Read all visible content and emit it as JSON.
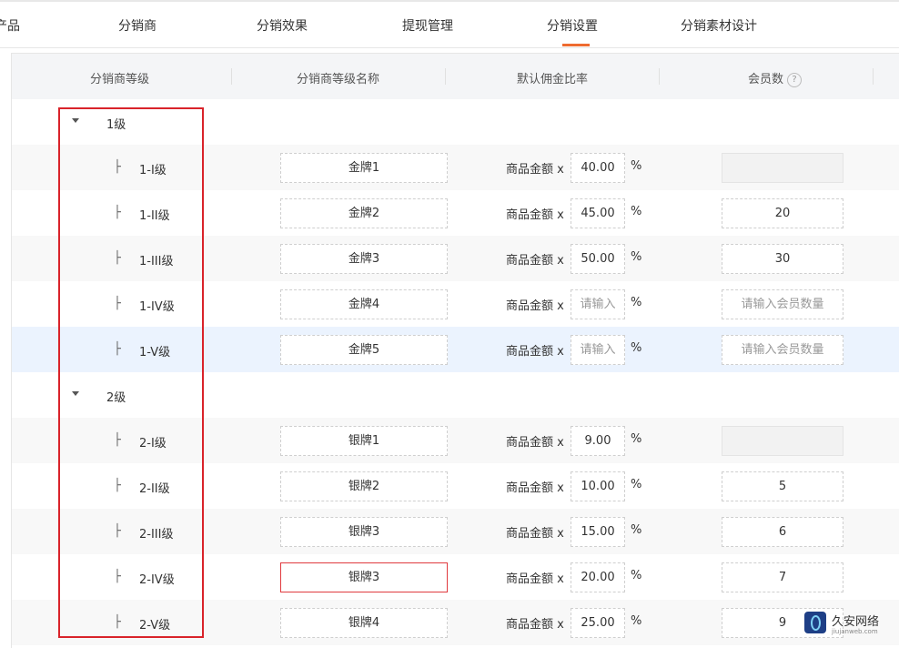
{
  "tabs": [
    {
      "label": "产品"
    },
    {
      "label": "分销商"
    },
    {
      "label": "分销效果"
    },
    {
      "label": "提现管理"
    },
    {
      "label": "分销设置"
    },
    {
      "label": "分销素材设计"
    }
  ],
  "active_tab": "分销设置",
  "table": {
    "headers": {
      "level": "分销商等级",
      "level_name": "分销商等级名称",
      "rate": "默认佣金比率",
      "members": "会员数",
      "members_help": "?"
    },
    "prefix": "商品金额 x",
    "percent": "%",
    "tree_branch": "├"
  },
  "groups": [
    {
      "label": "1级",
      "rows": [
        {
          "level": "1-I级",
          "name": "金牌1",
          "rate": "40.00",
          "members": ""
        },
        {
          "level": "1-II级",
          "name": "金牌2",
          "rate": "45.00",
          "members": "20"
        },
        {
          "level": "1-III级",
          "name": "金牌3",
          "rate": "50.00",
          "members": "30"
        },
        {
          "level": "1-IV级",
          "name": "金牌4",
          "rate_placeholder": "请输入",
          "members_placeholder": "请输入会员数量"
        },
        {
          "level": "1-V级",
          "name": "金牌5",
          "rate_placeholder": "请输入",
          "members_placeholder": "请输入会员数量"
        }
      ]
    },
    {
      "label": "2级",
      "rows": [
        {
          "level": "2-I级",
          "name": "银牌1",
          "rate": "9.00",
          "members": ""
        },
        {
          "level": "2-II级",
          "name": "银牌2",
          "rate": "10.00",
          "members": "5"
        },
        {
          "level": "2-III级",
          "name": "银牌3",
          "rate": "15.00",
          "members": "6"
        },
        {
          "level": "2-IV级",
          "name": "银牌3",
          "rate": "20.00",
          "members": "7"
        },
        {
          "level": "2-V级",
          "name": "银牌4",
          "rate": "25.00",
          "members": "9"
        }
      ]
    }
  ],
  "colors": {
    "accent": "#ee6b30",
    "highlight_box": "#d9232a",
    "error_border": "#e0393e",
    "hover_row": "#ebf3fe"
  },
  "watermark": {
    "name": "久安网络",
    "url": "jiujanweb.com"
  }
}
